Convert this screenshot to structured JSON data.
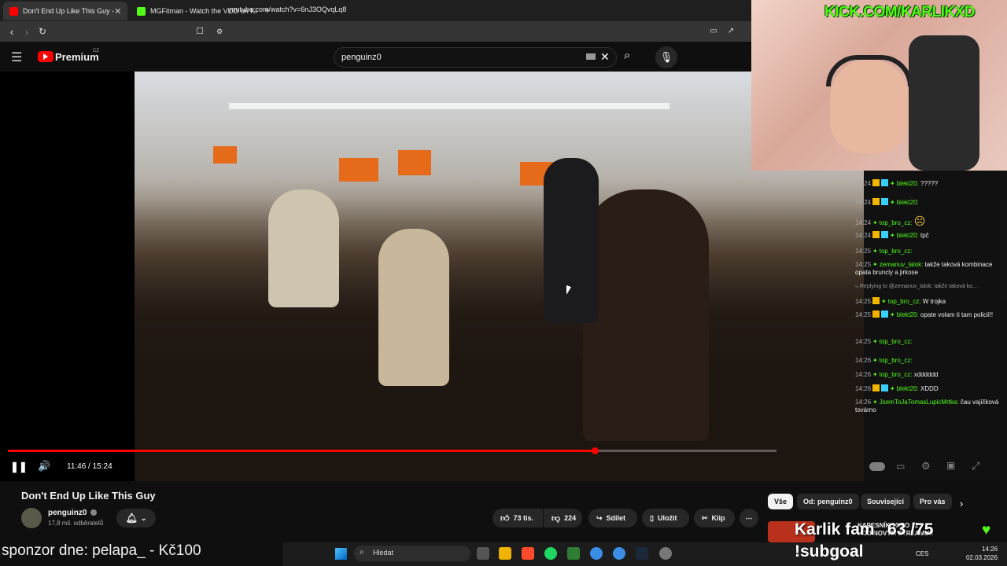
{
  "browser": {
    "tabs": [
      {
        "label": "Don't End Up Like This Guy -",
        "active": true,
        "favicon_color": "#ff0000"
      },
      {
        "label": "MGFitman - Watch the VOD on Kick",
        "active": false,
        "favicon_color": "#53fc18"
      }
    ],
    "new_tab": "+",
    "url": "youtube.com/watch?v=6nJ3OQvqLq8"
  },
  "youtube": {
    "logo_text": "Premium",
    "region": "CZ",
    "search_value": "penguinz0",
    "player": {
      "time": "11:46 / 15:24",
      "progress": 0.764
    },
    "video_title": "Don't End Up Like This Guy",
    "channel_name": "penguinz0",
    "subscribers": "17,8 mil. odběratelů",
    "actions": {
      "likes": "73 tis.",
      "dislikes": "224",
      "share": "Sdílet",
      "save": "Uložit",
      "clip": "Klip"
    },
    "chips": [
      "Vše",
      "Od: penguinz0",
      "Související",
      "Pro vás"
    ],
    "up_next_title": "KAPESNÍK 10 PO 12 HODINOVÝM STREAMU!!"
  },
  "stream": {
    "kick_title": "KICK.COM/KARLIKXD",
    "goal_label": "Karlik fam",
    "goal_count": "63 /75",
    "subgoal": "!subgoal",
    "sponsor": "sponzor dne: pelapa_ - Kč100"
  },
  "chat": [
    {
      "time": "14:24",
      "user": "blekt20:",
      "msg": "?????",
      "badges": 2
    },
    {
      "time": "14:24",
      "user": "blekt20:",
      "msg": "",
      "badges": 2
    },
    {
      "time": "14:24",
      "user": "top_bro_cz:",
      "msg": "☹",
      "badges": 0
    },
    {
      "time": "14:24",
      "user": "blekt20:",
      "msg": "tpč",
      "badges": 2
    },
    {
      "time": "14:25",
      "user": "top_bro_cz:",
      "msg": "",
      "badges": 0
    },
    {
      "time": "14:25",
      "user": "zemanuv_lalok:",
      "msg": "takže taková kombinace opata bruncly a jirkose",
      "badges": 0
    },
    {
      "time": "",
      "user": "Replying to @zemanuv_lalok:",
      "msg": "takže taková ko...",
      "badges": 0,
      "reply": true
    },
    {
      "time": "14:25",
      "user": "top_bro_cz:",
      "msg": "W trojka",
      "badges": 1
    },
    {
      "time": "14:25",
      "user": "blekt20:",
      "msg": "opate volam ti tam policii!!",
      "badges": 2
    },
    {
      "time": "14:25",
      "user": "top_bro_cz:",
      "msg": "",
      "badges": 0
    },
    {
      "time": "14:26",
      "user": "top_bro_cz:",
      "msg": "",
      "badges": 0
    },
    {
      "time": "14:26",
      "user": "top_bro_cz:",
      "msg": "xdddddd",
      "badges": 0
    },
    {
      "time": "14:26",
      "user": "blekt20:",
      "msg": "XDDD",
      "badges": 2
    },
    {
      "time": "14:26",
      "user": "JsemToJaTomasLupicMrtka:",
      "msg": "čau vajíčková továrno",
      "badges": 0
    }
  ],
  "taskbar": {
    "search": "Hledat",
    "lang": "CES",
    "time": "14:26",
    "date": "02.03.2026"
  },
  "colors": {
    "accent": "#ff0000",
    "kick_green": "#53fc18",
    "bg": "#0f0f0f"
  }
}
